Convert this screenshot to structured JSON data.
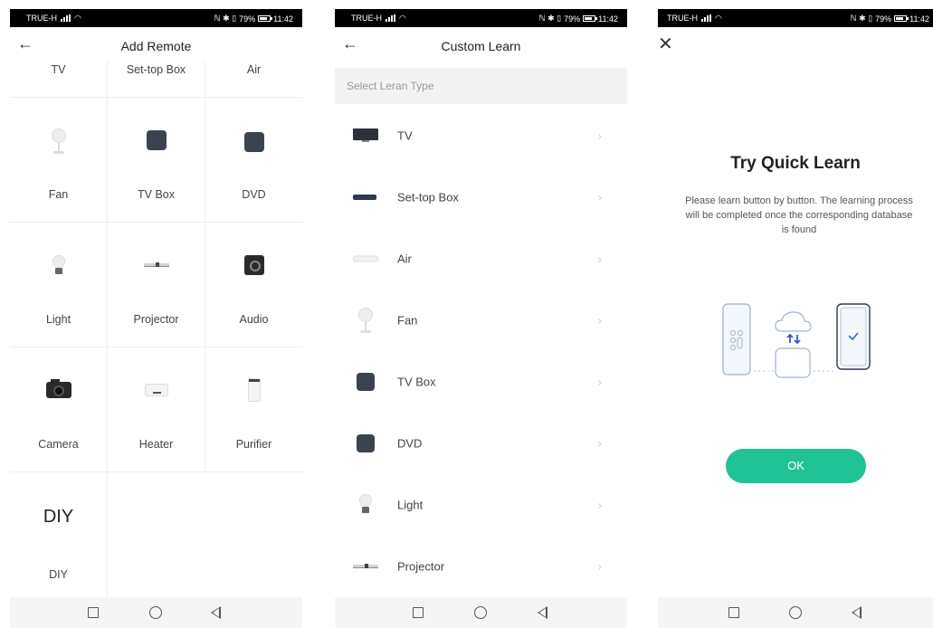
{
  "status_bar": {
    "carrier": "TRUE-H",
    "indicators": "ℕ ✱ ▯",
    "battery": "79%",
    "battery_level": 0.79,
    "time": "11:42"
  },
  "screen1": {
    "title": "Add Remote",
    "top_row": [
      "TV",
      "Set-top Box",
      "Air"
    ],
    "grid": [
      {
        "label": "Fan",
        "icon": "fan-icon"
      },
      {
        "label": "TV Box",
        "icon": "tv-box-icon"
      },
      {
        "label": "DVD",
        "icon": "dvd-icon"
      },
      {
        "label": "Light",
        "icon": "light-bulb-icon"
      },
      {
        "label": "Projector",
        "icon": "projector-icon"
      },
      {
        "label": "Audio",
        "icon": "audio-icon"
      },
      {
        "label": "Camera",
        "icon": "camera-icon"
      },
      {
        "label": "Heater",
        "icon": "heater-icon"
      },
      {
        "label": "Purifier",
        "icon": "purifier-icon"
      }
    ],
    "diy": {
      "icon_text": "DIY",
      "label": "DIY"
    }
  },
  "screen2": {
    "title": "Custom Learn",
    "section_header": "Select Leran Type",
    "items": [
      {
        "label": "TV",
        "icon": "tv-icon"
      },
      {
        "label": "Set-top Box",
        "icon": "set-top-box-icon"
      },
      {
        "label": "Air",
        "icon": "air-conditioner-icon"
      },
      {
        "label": "Fan",
        "icon": "fan-icon"
      },
      {
        "label": "TV Box",
        "icon": "tv-box-icon"
      },
      {
        "label": "DVD",
        "icon": "dvd-icon"
      },
      {
        "label": "Light",
        "icon": "light-bulb-icon"
      },
      {
        "label": "Projector",
        "icon": "projector-icon"
      }
    ]
  },
  "screen3": {
    "title": "Try Quick Learn",
    "description": "Please learn button by button. The learning process will be completed once the corresponding database is found",
    "ok_label": "OK",
    "accent": "#1fc395"
  },
  "nav_bar": {
    "icons": [
      "recent-apps-icon",
      "home-icon",
      "back-nav-icon"
    ]
  }
}
